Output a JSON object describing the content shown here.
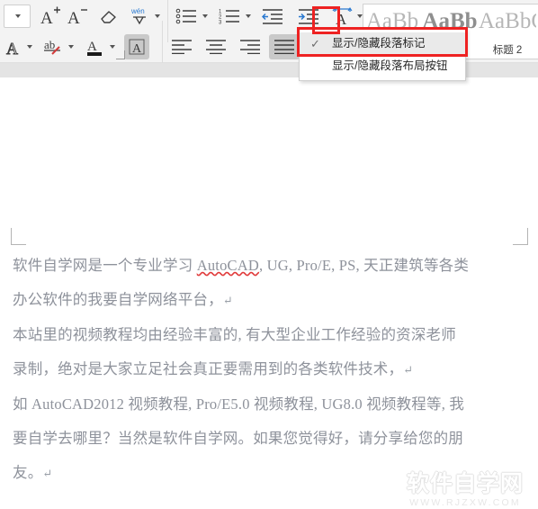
{
  "app": {
    "kind": "word-processor",
    "accent_blue": "#2878d0",
    "annotation_red": "#ee2222",
    "document_text_color": "#8e929b"
  },
  "ribbon": {
    "row1": [
      {
        "name": "font-size-box",
        "icon": "dropdown-box",
        "label": ""
      },
      {
        "name": "increase-font-size",
        "icon": "A-plus",
        "label": "A"
      },
      {
        "name": "decrease-font-size",
        "icon": "A-minus",
        "label": "A"
      },
      {
        "name": "clear-formatting",
        "icon": "eraser",
        "label": ""
      },
      {
        "name": "pinyin-guide",
        "icon": "wen-phonetic",
        "label": "wén"
      }
    ],
    "row2": [
      {
        "name": "text-effects",
        "icon": "A-effects",
        "label": "A"
      },
      {
        "name": "highlight-color",
        "icon": "highlighter",
        "label": "ab"
      },
      {
        "name": "font-color",
        "icon": "font-color",
        "label": "A"
      },
      {
        "name": "character-border",
        "icon": "char-border",
        "label": "A"
      }
    ],
    "paragraph_row1": [
      {
        "name": "bullet-list",
        "icon": "bullets"
      },
      {
        "name": "numbered-list",
        "icon": "numbering"
      },
      {
        "name": "decrease-indent",
        "icon": "decrease-indent"
      },
      {
        "name": "increase-indent",
        "icon": "increase-indent"
      },
      {
        "name": "asian-layout",
        "icon": "asian-layout"
      }
    ],
    "paragraph_row2": [
      {
        "name": "align-left",
        "icon": "align-left"
      },
      {
        "name": "align-center",
        "icon": "align-center"
      },
      {
        "name": "align-right",
        "icon": "align-right"
      },
      {
        "name": "align-justify",
        "icon": "align-justify",
        "active": true
      },
      {
        "name": "distribute-text",
        "icon": "distributed"
      },
      {
        "name": "line-spacing",
        "icon": "line-spacing"
      }
    ],
    "paragraph_row3": [
      {
        "name": "sort",
        "icon": "sort-az"
      },
      {
        "name": "show-paragraph-marks",
        "icon": "pilcrow-toggle"
      },
      {
        "name": "borders",
        "icon": "table-borders"
      },
      {
        "name": "shading",
        "icon": "shading-bucket"
      }
    ]
  },
  "style_gallery": {
    "items": [
      {
        "sample": "AaBb",
        "name": "",
        "bold": false
      },
      {
        "sample": "AaBb",
        "name": "",
        "bold": true
      },
      {
        "sample": "AaBbC",
        "name": "标题 2",
        "bold": false
      }
    ]
  },
  "dropdown_menu": {
    "items": [
      {
        "label": "显示/隐藏段落标记",
        "checked": true,
        "check_glyph": "✓"
      },
      {
        "label": "显示/隐藏段落布局按钮",
        "checked": false,
        "check_glyph": ""
      }
    ]
  },
  "annotations": [
    {
      "name": "redbox-dropdown-arrow",
      "shape": "rectangle",
      "color": "#ee2222"
    },
    {
      "name": "redbox-menu-item",
      "shape": "rectangle",
      "color": "#ee2222"
    }
  ],
  "document": {
    "paragraphs": [
      {
        "id": "p1-line1",
        "runs": [
          {
            "text": "软件自学网是一个专业学习 "
          },
          {
            "text": "AutoCAD",
            "spellcheck_error": true
          },
          {
            "text": ", UG, Pro/E, PS, 天正建筑等各类"
          }
        ],
        "pilcrow": false
      },
      {
        "id": "p1-line2",
        "runs": [
          {
            "text": "办公软件的我要自学网络平台，"
          }
        ],
        "pilcrow": true
      },
      {
        "id": "p2-line1",
        "runs": [
          {
            "text": "本站里的视频教程均由经验丰富的, 有大型企业工作经验的资深老师"
          }
        ],
        "pilcrow": false
      },
      {
        "id": "p2-line2",
        "runs": [
          {
            "text": "录制，绝对是大家立足社会真正要需用到的各类软件技术，"
          }
        ],
        "pilcrow": true
      },
      {
        "id": "p3-line1",
        "runs": [
          {
            "text": "如 AutoCAD2012 视频教程, Pro/E5.0 视频教程, UG8.0 视频教程等, 我"
          }
        ],
        "pilcrow": false
      },
      {
        "id": "p3-line2",
        "runs": [
          {
            "text": "要自学去哪里？当然是软件自学网。如果您觉得好，请分享给您的朋"
          }
        ],
        "pilcrow": false
      },
      {
        "id": "p3-line3",
        "runs": [
          {
            "text": "友。"
          }
        ],
        "pilcrow": true
      }
    ],
    "pilcrow_glyph": "↵"
  },
  "watermark": {
    "main": "软件自学网",
    "sub": "WWW.RJZXW.COM"
  }
}
